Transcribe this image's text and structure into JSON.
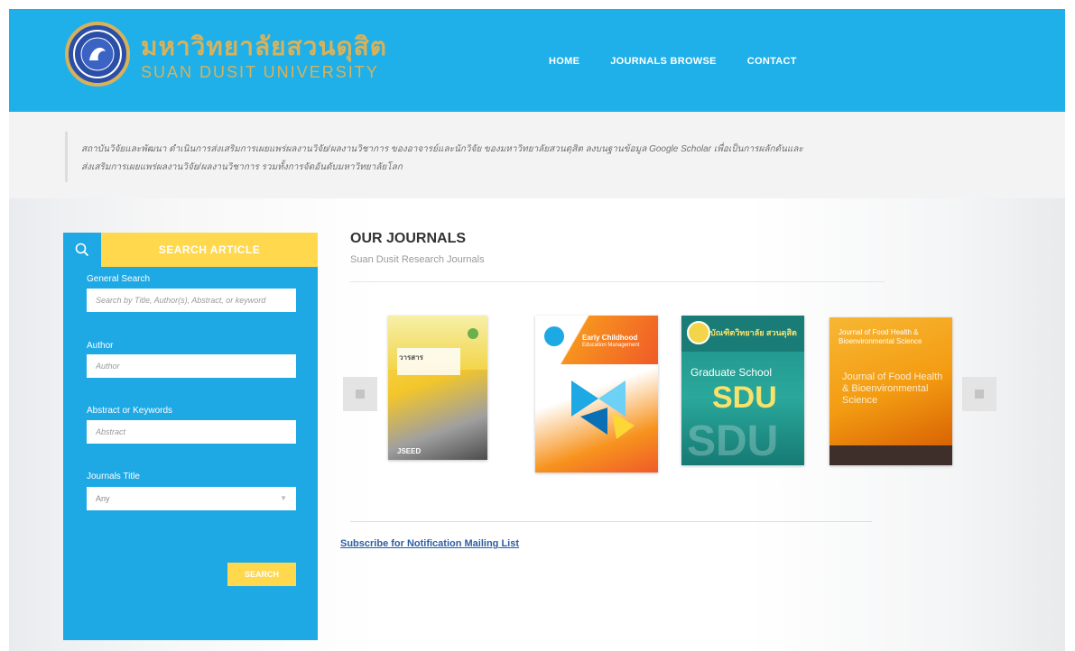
{
  "header": {
    "title_th": "มหาวิทยาลัยสวนดุสิต",
    "title_en": "SUAN DUSIT UNIVERSITY",
    "nav": [
      {
        "label": "HOME"
      },
      {
        "label": "JOURNALS BROWSE"
      },
      {
        "label": "CONTACT"
      }
    ]
  },
  "intro": {
    "line1": "สถาบันวิจัยและพัฒนา ดำเนินการส่งเสริมการเผยแพร่ผลงานวิจัย/ผลงานวิชาการ ของอาจารย์และนักวิจัย ของมหาวิทยาลัยสวนดุสิต ลงบนฐานข้อมูล Google Scholar เพื่อเป็นการผลักดันและ",
    "line2": "ส่งเสริมการเผยแพร่ผลงานวิจัย/ผลงานวิชาการ รวมทั้งการจัดอันดับมหาวิทยาลัยโลก"
  },
  "search": {
    "title": "SEARCH ARTICLE",
    "general_label": "General Search",
    "general_placeholder": "Search by Title, Author(s), Abstract, or keyword",
    "author_label": "Author",
    "author_placeholder": "Author",
    "abstract_label": "Abstract or Keywords",
    "abstract_placeholder": "Abstract",
    "journal_label": "Journals Title",
    "journal_selected": "Any",
    "button_label": "SEARCH"
  },
  "journals": {
    "title": "OUR JOURNALS",
    "subtitle": "Suan Dusit Research Journals",
    "covers": [
      {
        "text_top": "วารสาร",
        "text_bottom": "JSEED"
      },
      {
        "text_top": "Early Childhood",
        "text_bottom": "Education Management"
      },
      {
        "text_top": "บัณฑิตวิทยาลัย สวนดุสิต",
        "text_mid1": "Graduate School",
        "text_mid2": "SDU",
        "text_bottom": "SDU"
      },
      {
        "text_top": "Journal of Food Health & Bioenvironmental Science",
        "text_bottom": "Journal of Food Health & Bioenvironmental Science"
      }
    ],
    "subscribe_label": "Subscribe for Notification Mailing List"
  },
  "colors": {
    "header_bg": "#1fb0ea",
    "search_panel_bg": "#1ea8e4",
    "accent_yellow": "#ffd84d",
    "link_blue": "#2b5ea6"
  }
}
